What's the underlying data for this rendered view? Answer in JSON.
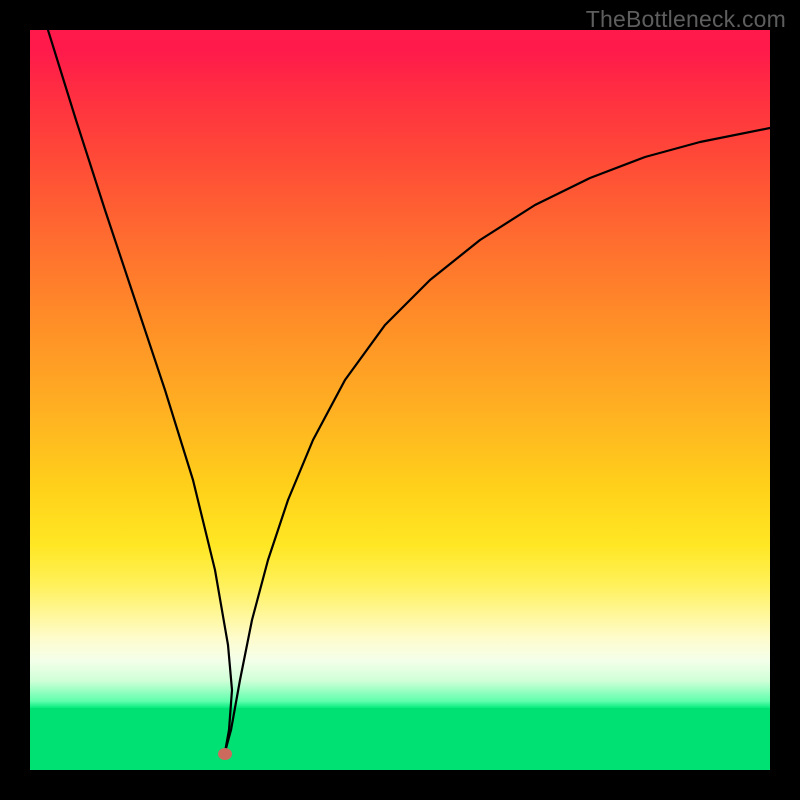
{
  "watermark": "TheBottleneck.com",
  "colors": {
    "frame": "#000000",
    "marker": "#cd6a5e",
    "curve": "#000000",
    "gradient_top": "#ff1a4b",
    "gradient_bottom": "#07eb7e",
    "green_band": "#00e173"
  },
  "chart_data": {
    "type": "line",
    "title": "",
    "xlabel": "",
    "ylabel": "",
    "xlim": [
      0,
      100
    ],
    "ylim": [
      0,
      100
    ],
    "background": "vertical-gradient red→orange→yellow→green with solid green band at bottom",
    "annotations": [
      {
        "kind": "marker",
        "x": 26,
        "y": 2,
        "shape": "ellipse",
        "color": "#cd6a5e"
      }
    ],
    "series": [
      {
        "name": "left-branch",
        "x": [
          2,
          5,
          8,
          11,
          14,
          17,
          20,
          23,
          25,
          26.2
        ],
        "y": [
          100,
          88,
          76,
          64,
          52,
          40,
          28,
          16,
          8,
          2
        ]
      },
      {
        "name": "right-branch",
        "x": [
          26.2,
          28,
          30,
          32,
          35,
          38,
          42,
          46,
          50,
          55,
          60,
          66,
          72,
          78,
          85,
          92,
          100
        ],
        "y": [
          2,
          12,
          22,
          31,
          41,
          49,
          57,
          63,
          68,
          72,
          76,
          79,
          82,
          84,
          86,
          88,
          89
        ]
      }
    ]
  }
}
